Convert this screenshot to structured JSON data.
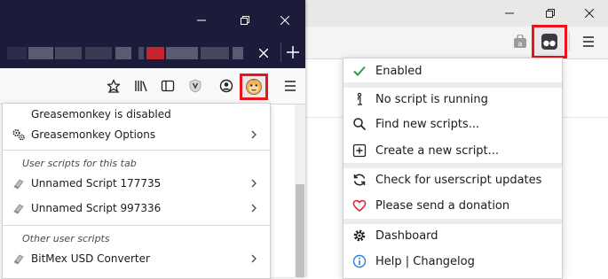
{
  "left_panel": {
    "status": "Greasemonkey is disabled",
    "options_label": "Greasemonkey Options",
    "tab_scripts_heading": "User scripts for this tab",
    "tab_scripts": [
      {
        "label": "Unnamed Script 177735"
      },
      {
        "label": "Unnamed Script 997336"
      }
    ],
    "other_scripts_heading": "Other user scripts",
    "other_scripts": [
      {
        "label": "BitMex USD Converter"
      }
    ]
  },
  "right_menu": {
    "enabled_label": "Enabled",
    "no_script_label": "No script is running",
    "find_label": "Find new scripts...",
    "create_label": "Create a new script...",
    "check_updates_label": "Check for userscript updates",
    "donation_label": "Please send a donation",
    "dashboard_label": "Dashboard",
    "help_label": "Help | Changelog"
  },
  "colors": {
    "highlight_border": "#e8151b",
    "check_green": "#2e9e3f",
    "heart_red": "#d7263d",
    "info_blue": "#2f7bd6",
    "titlebar_dark": "#1c1b3a"
  },
  "icons": {
    "library": "library-icon",
    "sidebar": "sidebar-icon",
    "account": "account-icon",
    "menu": "hamburger-menu-icon"
  }
}
